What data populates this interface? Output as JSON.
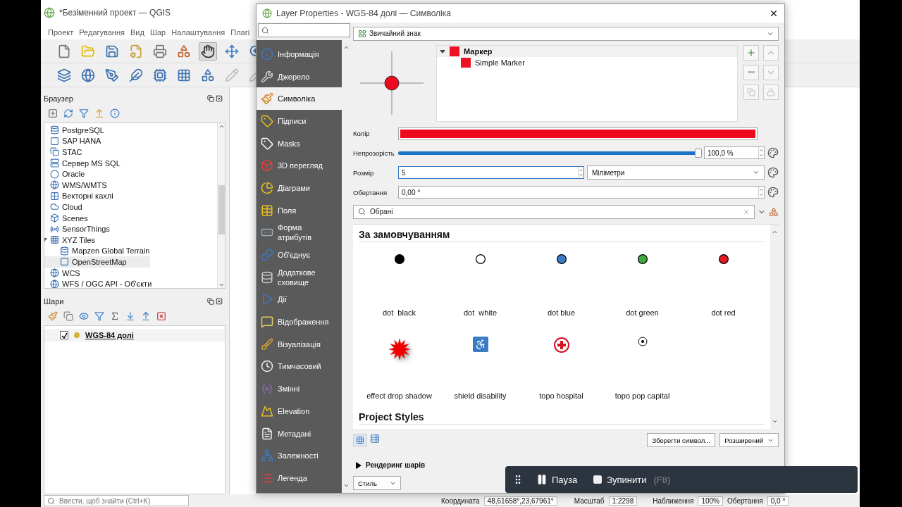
{
  "main_window": {
    "title": "*Безіменний проект — QGIS",
    "menu": [
      "Проект",
      "Редагування",
      "Вид",
      "Шар",
      "Налаштування",
      "Плагі"
    ],
    "browser": {
      "title": "Браузер",
      "items": [
        {
          "label": "PostgreSQL",
          "selected": false
        },
        {
          "label": "SAP HANA",
          "selected": false
        },
        {
          "label": "STAC",
          "selected": false
        },
        {
          "label": "Сервер MS SQL",
          "selected": false
        },
        {
          "label": "Oracle",
          "selected": false
        },
        {
          "label": "WMS/WMTS",
          "selected": false
        },
        {
          "label": "Векторні кахлі",
          "selected": false
        },
        {
          "label": "Cloud",
          "selected": false
        },
        {
          "label": "Scenes",
          "selected": false
        },
        {
          "label": "SensorThings",
          "selected": false
        },
        {
          "label": "XYZ Tiles",
          "selected": false,
          "expanded": true,
          "children": [
            {
              "label": "Mapzen Global Terrain",
              "selected": false
            },
            {
              "label": "OpenStreetMap",
              "selected": true
            }
          ]
        },
        {
          "label": "WCS",
          "selected": false
        },
        {
          "label": "WFS / OGC API - Об'єкти",
          "selected": false
        }
      ]
    },
    "layers": {
      "title": "Шари",
      "items": [
        {
          "label": "WGS-84 долі",
          "checked": true
        }
      ]
    },
    "search": {
      "placeholder": "Ввести, щоб знайти (Ctrl+K)"
    },
    "status_bar": {
      "coordinate_label": "Координата",
      "coordinate": "48,61658°,23,67961°",
      "scale_label": "Масштаб",
      "scale": "1:2298",
      "zoom_label": "Наближення",
      "zoom": "100%",
      "rotation_label": "Обертання",
      "rotation": "0,0 °"
    }
  },
  "dialog": {
    "title": "Layer Properties - WGS-84 долі — Символіка",
    "nav": [
      {
        "label": "Інформація",
        "selected": false
      },
      {
        "label": "Джерело",
        "selected": false
      },
      {
        "label": "Символіка",
        "selected": true
      },
      {
        "label": "Підписи",
        "selected": false
      },
      {
        "label": "Masks",
        "selected": false
      },
      {
        "label": "3D перегляд",
        "selected": false
      },
      {
        "label": "Діаграми",
        "selected": false
      },
      {
        "label": "Поля",
        "selected": false
      },
      {
        "label": "Форма атрибутів",
        "selected": false
      },
      {
        "label": "Об'єднує",
        "selected": false
      },
      {
        "label": "Додаткове сховище",
        "selected": false
      },
      {
        "label": "Дії",
        "selected": false
      },
      {
        "label": "Відображення",
        "selected": false
      },
      {
        "label": "Візуалізація",
        "selected": false
      },
      {
        "label": "Тимчасовий",
        "selected": false
      },
      {
        "label": "Змінні",
        "selected": false
      },
      {
        "label": "Elevation",
        "selected": false
      },
      {
        "label": "Метадані",
        "selected": false
      },
      {
        "label": "Залежності",
        "selected": false
      },
      {
        "label": "Легенда",
        "selected": false
      }
    ],
    "renderer": "Звичайний знак",
    "symbol_tree": [
      {
        "label": "Маркер",
        "expanded": true,
        "color": "#ee1122",
        "children": [
          {
            "label": "Simple Marker",
            "color": "#ee1122"
          }
        ]
      }
    ],
    "color": {
      "label": "Колір",
      "color": "#ee0a1e"
    },
    "opacity": {
      "label": "Непрозорість",
      "level": 0.99,
      "reading": "100,0 %"
    },
    "size": {
      "label": "Розмір",
      "value": "5",
      "unit": "Міліметри"
    },
    "rotation": {
      "label": "Обертання",
      "value": "0,00 °"
    },
    "library_search": {
      "value": "Обрані"
    },
    "sections": [
      {
        "title": "За замовчуванням",
        "symbols": [
          {
            "label": "dot  black",
            "kind": "dot",
            "color": "#000000"
          },
          {
            "label": "dot  white",
            "kind": "dot",
            "color": "#ffffff"
          },
          {
            "label": "dot blue",
            "kind": "dot",
            "color": "#3a7bc4"
          },
          {
            "label": "dot green",
            "kind": "dot",
            "color": "#3faa3f"
          },
          {
            "label": "dot red",
            "kind": "dot",
            "color": "#e01b24"
          },
          {
            "label": "effect drop shadow",
            "kind": "starburst",
            "color": "#ee0000"
          },
          {
            "label": "shield disability",
            "kind": "shield",
            "color": "#3a7bc4"
          },
          {
            "label": "topo hospital",
            "kind": "hospital",
            "color": "#d4111e"
          },
          {
            "label": "topo pop capital",
            "kind": "capital"
          }
        ]
      },
      {
        "title": "Project Styles"
      }
    ],
    "save_button": "Зберегти символ...",
    "advanced_button": "Розширений",
    "rendering": {
      "label": "Рендеринг шарів",
      "expanded": false
    },
    "style_button": "Стиль"
  },
  "recorder": {
    "pause": "Пауза",
    "stop": "Зупинити",
    "stop_key": "(F8)"
  }
}
